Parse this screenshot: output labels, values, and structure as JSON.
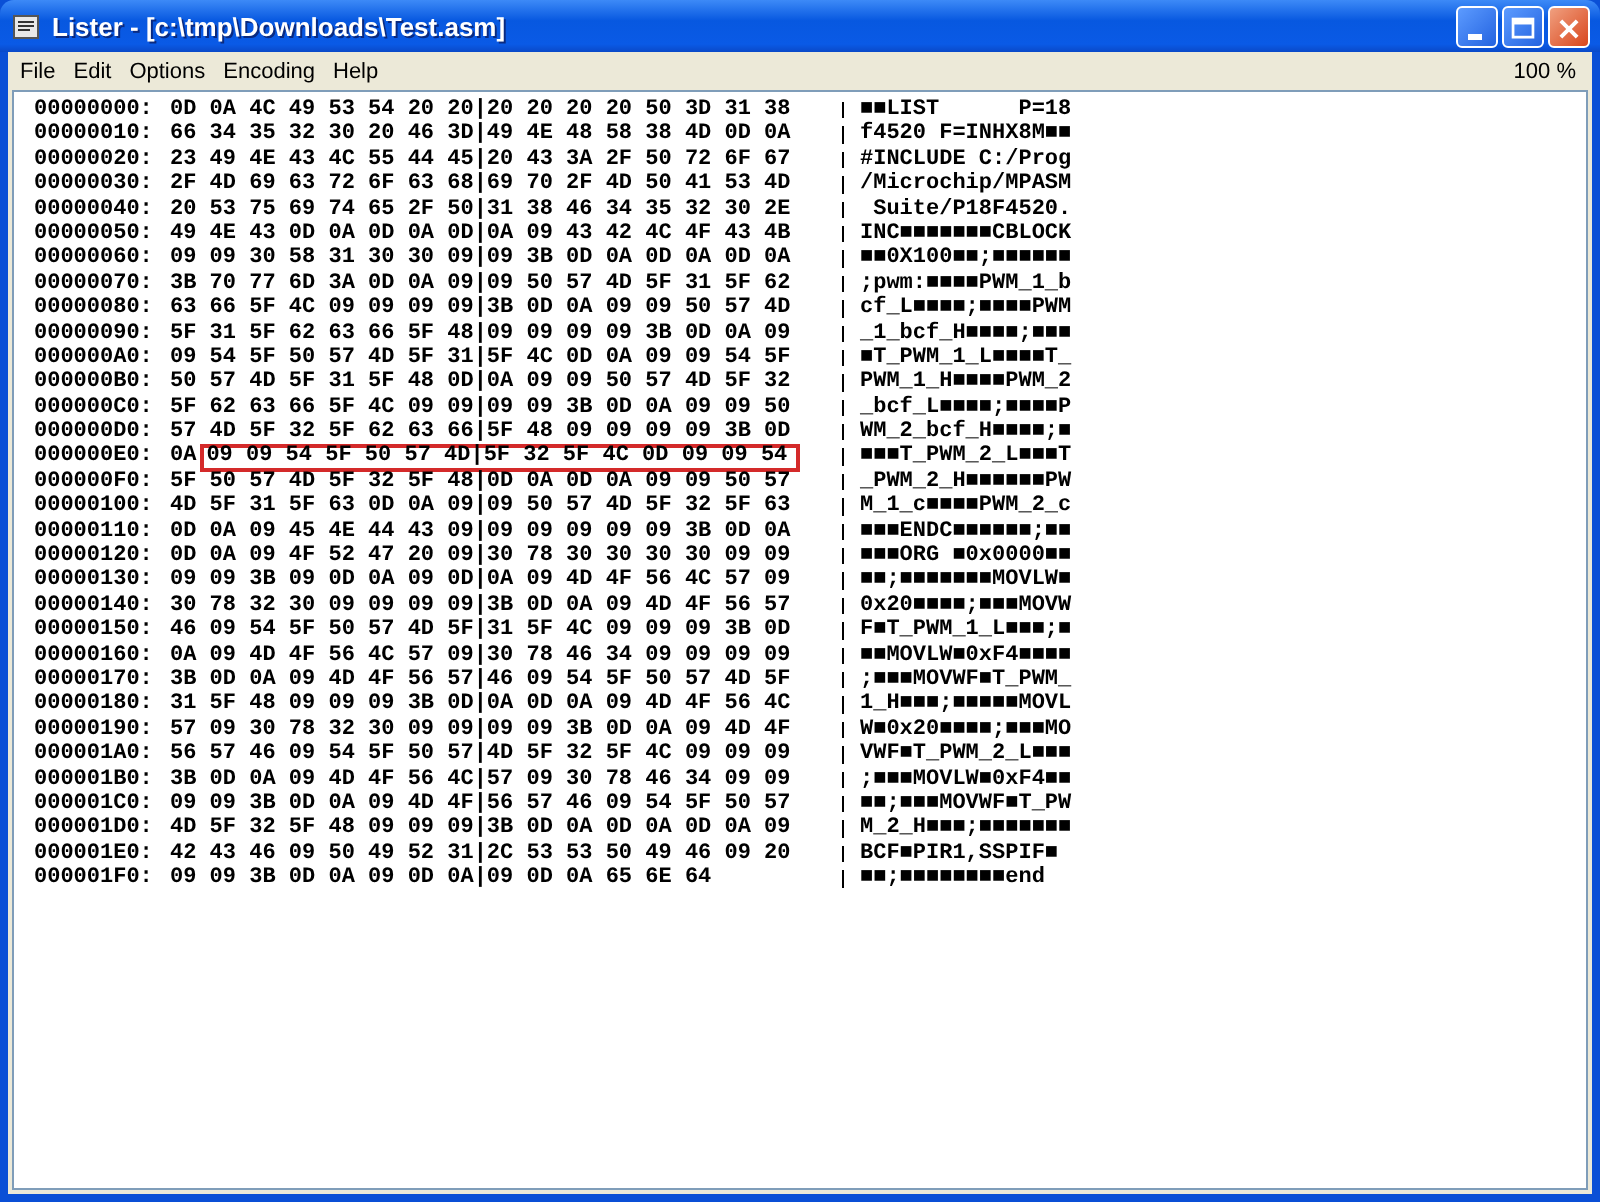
{
  "window": {
    "title": "Lister - [c:\\tmp\\Downloads\\Test.asm]"
  },
  "menu": [
    "File",
    "Edit",
    "Options",
    "Encoding",
    "Help"
  ],
  "zoom": "100 %",
  "rows": [
    {
      "address": "00000000:",
      "hex": "0D 0A 4C 49 53 54 20 20|20 20 20 20 50 3D 31 38",
      "text": "■■LIST      P=18"
    },
    {
      "address": "00000010:",
      "hex": "66 34 35 32 30 20 46 3D|49 4E 48 58 38 4D 0D 0A",
      "text": "f4520 F=INHX8M■■"
    },
    {
      "address": "00000020:",
      "hex": "23 49 4E 43 4C 55 44 45|20 43 3A 2F 50 72 6F 67",
      "text": "#INCLUDE C:/Prog"
    },
    {
      "address": "00000030:",
      "hex": "2F 4D 69 63 72 6F 63 68|69 70 2F 4D 50 41 53 4D",
      "text": "/Microchip/MPASM"
    },
    {
      "address": "00000040:",
      "hex": "20 53 75 69 74 65 2F 50|31 38 46 34 35 32 30 2E",
      "text": " Suite/P18F4520."
    },
    {
      "address": "00000050:",
      "hex": "49 4E 43 0D 0A 0D 0A 0D|0A 09 43 42 4C 4F 43 4B",
      "text": "INC■■■■■■■CBLOCK"
    },
    {
      "address": "00000060:",
      "hex": "09 09 30 58 31 30 30 09|09 3B 0D 0A 0D 0A 0D 0A",
      "text": "■■0X100■■;■■■■■■"
    },
    {
      "address": "00000070:",
      "hex": "3B 70 77 6D 3A 0D 0A 09|09 50 57 4D 5F 31 5F 62",
      "text": ";pwm:■■■■PWM_1_b"
    },
    {
      "address": "00000080:",
      "hex": "63 66 5F 4C 09 09 09 09|3B 0D 0A 09 09 50 57 4D",
      "text": "cf_L■■■■;■■■■PWM"
    },
    {
      "address": "00000090:",
      "hex": "5F 31 5F 62 63 66 5F 48|09 09 09 09 3B 0D 0A 09",
      "text": "_1_bcf_H■■■■;■■■"
    },
    {
      "address": "000000A0:",
      "hex": "09 54 5F 50 57 4D 5F 31|5F 4C 0D 0A 09 09 54 5F",
      "text": "■T_PWM_1_L■■■■T_"
    },
    {
      "address": "000000B0:",
      "hex": "50 57 4D 5F 31 5F 48 0D|0A 09 09 50 57 4D 5F 32",
      "text": "PWM_1_H■■■■PWM_2"
    },
    {
      "address": "000000C0:",
      "hex": "5F 62 63 66 5F 4C 09 09|09 09 3B 0D 0A 09 09 50",
      "text": "_bcf_L■■■■;■■■■P"
    },
    {
      "address": "000000D0:",
      "hex": "57 4D 5F 32 5F 62 63 66|5F 48 09 09 09 09 3B 0D",
      "text": "WM_2_bcf_H■■■■;■"
    },
    {
      "address": "000000E0:",
      "hex": "0A",
      "marked": "09 09 54 5F 50 57 4D|5F 32 5F 4C 0D 09 09 54",
      "text": "■■■T_PWM_2_L■■■T"
    },
    {
      "address": "000000F0:",
      "hex": "5F 50 57 4D 5F 32 5F 48|0D 0A 0D 0A 09 09 50 57",
      "text": "_PWM_2_H■■■■■■PW"
    },
    {
      "address": "00000100:",
      "hex": "4D 5F 31 5F 63 0D 0A 09|09 50 57 4D 5F 32 5F 63",
      "text": "M_1_c■■■■PWM_2_c"
    },
    {
      "address": "00000110:",
      "hex": "0D 0A 09 45 4E 44 43 09|09 09 09 09 09 3B 0D 0A",
      "text": "■■■ENDC■■■■■■;■■"
    },
    {
      "address": "00000120:",
      "hex": "0D 0A 09 4F 52 47 20 09|30 78 30 30 30 30 09 09",
      "text": "■■■ORG ■0x0000■■"
    },
    {
      "address": "00000130:",
      "hex": "09 09 3B 09 0D 0A 09 0D|0A 09 4D 4F 56 4C 57 09",
      "text": "■■;■■■■■■■MOVLW■"
    },
    {
      "address": "00000140:",
      "hex": "30 78 32 30 09 09 09 09|3B 0D 0A 09 4D 4F 56 57",
      "text": "0x20■■■■;■■■MOVW"
    },
    {
      "address": "00000150:",
      "hex": "46 09 54 5F 50 57 4D 5F|31 5F 4C 09 09 09 3B 0D",
      "text": "F■T_PWM_1_L■■■;■"
    },
    {
      "address": "00000160:",
      "hex": "0A 09 4D 4F 56 4C 57 09|30 78 46 34 09 09 09 09",
      "text": "■■MOVLW■0xF4■■■■"
    },
    {
      "address": "00000170:",
      "hex": "3B 0D 0A 09 4D 4F 56 57|46 09 54 5F 50 57 4D 5F",
      "text": ";■■■MOVWF■T_PWM_"
    },
    {
      "address": "00000180:",
      "hex": "31 5F 48 09 09 09 3B 0D|0A 0D 0A 09 4D 4F 56 4C",
      "text": "1_H■■■;■■■■■MOVL"
    },
    {
      "address": "00000190:",
      "hex": "57 09 30 78 32 30 09 09|09 09 3B 0D 0A 09 4D 4F",
      "text": "W■0x20■■■■;■■■MO"
    },
    {
      "address": "000001A0:",
      "hex": "56 57 46 09 54 5F 50 57|4D 5F 32 5F 4C 09 09 09",
      "text": "VWF■T_PWM_2_L■■■"
    },
    {
      "address": "000001B0:",
      "hex": "3B 0D 0A 09 4D 4F 56 4C|57 09 30 78 46 34 09 09",
      "text": ";■■■MOVLW■0xF4■■"
    },
    {
      "address": "000001C0:",
      "hex": "09 09 3B 0D 0A 09 4D 4F|56 57 46 09 54 5F 50 57",
      "text": "■■;■■■MOVWF■T_PW"
    },
    {
      "address": "000001D0:",
      "hex": "4D 5F 32 5F 48 09 09 09|3B 0D 0A 0D 0A 0D 0A 09",
      "text": "M_2_H■■■;■■■■■■■"
    },
    {
      "address": "000001E0:",
      "hex": "42 43 46 09 50 49 52 31|2C 53 53 50 49 46 09 20",
      "text": "BCF■PIR1,SSPIF■ "
    },
    {
      "address": "000001F0:",
      "hex": "09 09 3B 0D 0A 09 0D 0A|09 0D 0A 65 6E 64",
      "text": "■■;■■■■■■■■end"
    }
  ]
}
